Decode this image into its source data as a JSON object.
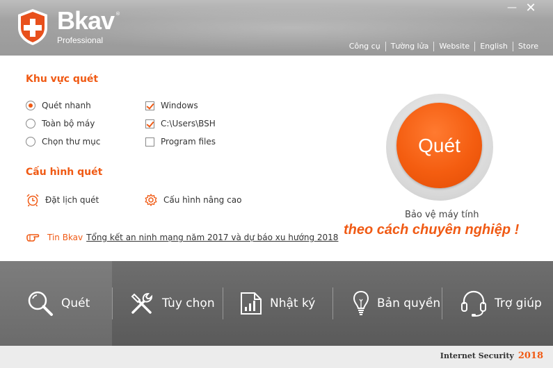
{
  "header": {
    "brand": "Bkav",
    "brand_mark": "®",
    "edition": "Professional",
    "minimize": "—",
    "close": "✕",
    "links": [
      "Công cụ",
      "Tường lửa",
      "Website",
      "English",
      "Store"
    ]
  },
  "scan_area": {
    "title": "Khu vực quét",
    "modes": [
      {
        "label": "Quét nhanh",
        "selected": true
      },
      {
        "label": "Toàn bộ máy",
        "selected": false
      },
      {
        "label": "Chọn thư mục",
        "selected": false
      }
    ],
    "targets": [
      {
        "label": "Windows",
        "checked": true
      },
      {
        "label": "C:\\Users\\BSH",
        "checked": true
      },
      {
        "label": "Program files",
        "checked": false
      }
    ]
  },
  "scan_config": {
    "title": "Cấu hình quét",
    "schedule": "Đặt lịch quét",
    "advanced": "Cấu hình nâng cao"
  },
  "news": {
    "label": "Tin Bkav",
    "text": "Tổng kết an ninh mạng năm 2017 và dự báo xu hướng 2018"
  },
  "scan_button": "Quét",
  "slogan": {
    "line1": "Bảo vệ máy tính",
    "line2": "theo cách chuyên nghiệp !"
  },
  "nav": {
    "scan": "Quét",
    "options": "Tùy chọn",
    "log": "Nhật ký",
    "license": "Bản quyền",
    "help": "Trợ giúp"
  },
  "footer": {
    "product": "Internet Security",
    "year": "2018"
  },
  "colors": {
    "accent": "#f05a14",
    "nav_bg": "#5f5f5f",
    "header_bg": "#a3a3a3"
  }
}
